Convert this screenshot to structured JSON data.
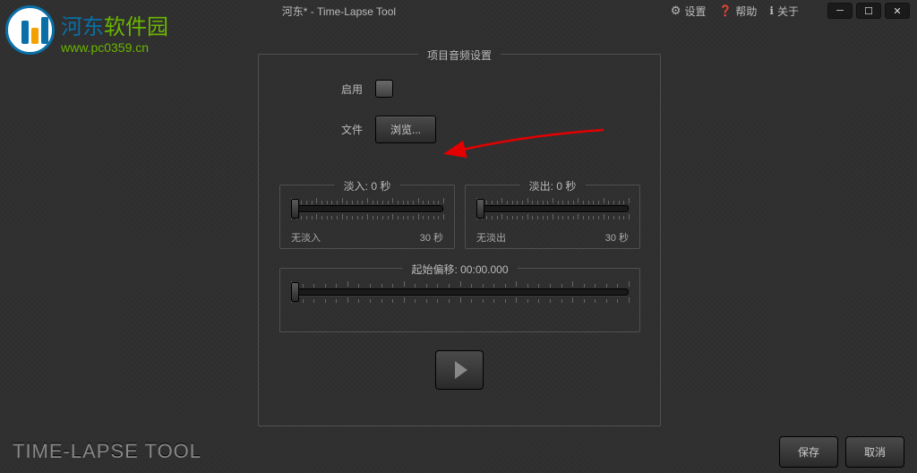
{
  "window": {
    "title": "河东* - Time-Lapse Tool"
  },
  "menu": {
    "settings": "设置",
    "help": "帮助",
    "about": "关于"
  },
  "logo": {
    "name_pre": "河东",
    "name_suf": "软件园",
    "url": "www.pc0359.cn"
  },
  "panel": {
    "title": "项目音频设置",
    "enable_label": "启用",
    "file_label": "文件",
    "browse": "浏览...",
    "fadein": {
      "title": "淡入: 0 秒",
      "left": "无淡入",
      "right": "30 秒"
    },
    "fadeout": {
      "title": "淡出: 0 秒",
      "left": "无淡出",
      "right": "30 秒"
    },
    "offset": {
      "title": "起始偏移: 00:00.000"
    }
  },
  "footer": {
    "brand": "TIME-LAPSE TOOL",
    "save": "保存",
    "cancel": "取消"
  }
}
